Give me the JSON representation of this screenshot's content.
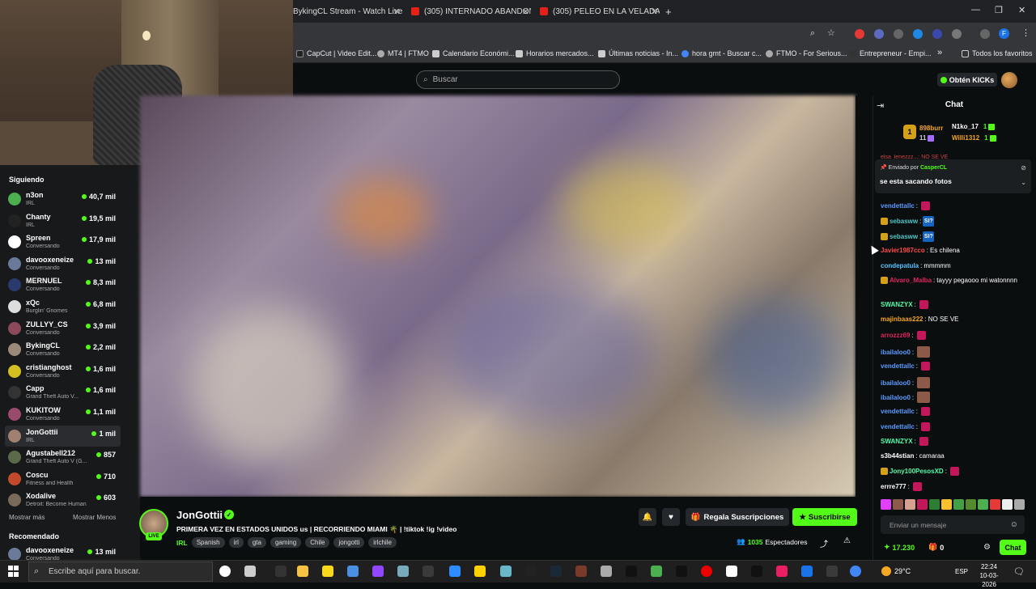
{
  "browser": {
    "tabs": [
      {
        "title": "BykingCL Stream - Watch Live o"
      },
      {
        "title": "(305) INTERNADO ABANDONA"
      },
      {
        "title": "(305) PELEO EN LA VELADA DE"
      }
    ],
    "new_tab": "+",
    "bookmarks": [
      "CapCut | Video Edit...",
      "MT4 | FTMO",
      "Calendario Económi...",
      "Horarios mercados...",
      "Últimas noticias - In...",
      "hora gmt - Buscar c...",
      "FTMO - For Serious...",
      "Entrepreneur - Empi..."
    ],
    "bookmarks_more": "»",
    "all_favorites": "Todos los favoritos",
    "profile_initial": "F"
  },
  "kick": {
    "search_placeholder": "Buscar",
    "get_kicks": "Obtén KICKs"
  },
  "sidebar": {
    "following_title": "Siguiendo",
    "following": [
      {
        "name": "n3on",
        "category": "IRL",
        "viewers": "40,7 mil",
        "color": "#4caf50"
      },
      {
        "name": "Chanty",
        "category": "IRL",
        "viewers": "19,5 mil",
        "color": "#222"
      },
      {
        "name": "Spreen",
        "category": "Conversando",
        "viewers": "17,9 mil",
        "color": "#ffffff"
      },
      {
        "name": "davooxeneize",
        "category": "Conversando",
        "viewers": "13 mil",
        "color": "#6a7a9a"
      },
      {
        "name": "MERNUEL",
        "category": "Conversando",
        "viewers": "8,3 mil",
        "color": "#2a3a6a"
      },
      {
        "name": "xQc",
        "category": "Burglin' Gnomes",
        "viewers": "6,8 mil",
        "color": "#ddd"
      },
      {
        "name": "ZULLYY_CS",
        "category": "Conversando",
        "viewers": "3,9 mil",
        "color": "#8a4a5a"
      },
      {
        "name": "BykingCL",
        "category": "Conversando",
        "viewers": "2,2 mil",
        "color": "#9a8a7a"
      },
      {
        "name": "cristianghost",
        "category": "Conversando",
        "viewers": "1,6 mil",
        "color": "#d4c020"
      },
      {
        "name": "Capp",
        "category": "Grand Theft Auto V...",
        "viewers": "1,6 mil",
        "color": "#333"
      },
      {
        "name": "KUKITOW",
        "category": "Conversando",
        "viewers": "1,1 mil",
        "color": "#9a4a6a"
      },
      {
        "name": "JonGottii",
        "category": "IRL",
        "viewers": "1 mil",
        "color": "#a08070",
        "selected": true
      },
      {
        "name": "Agustabell212",
        "category": "Grand Theft Auto V (G...",
        "viewers": "857",
        "color": "#5a6a4a"
      },
      {
        "name": "Coscu",
        "category": "Fitness and Health",
        "viewers": "710",
        "color": "#c04a2a"
      },
      {
        "name": "Xodalive",
        "category": "Detroit: Become Human",
        "viewers": "603",
        "color": "#7a6a5a"
      }
    ],
    "show_more": "Mostrar más",
    "show_less": "Mostrar Menos",
    "recommended_title": "Recomendado",
    "recommended": [
      {
        "name": "davooxeneize",
        "category": "Conversando",
        "viewers": "13 mil",
        "color": "#6a7a9a"
      }
    ]
  },
  "stream": {
    "channel": "JonGottii",
    "live_badge": "LIVE",
    "title": "PRIMERA VEZ EN ESTADOS UNIDOS us | RECORRIENDO MIAMI 🌴 | !tiktok !ig !video",
    "category": "IRL",
    "tags": [
      "Spanish",
      "irl",
      "gta",
      "gaming",
      "Chile",
      "jongotti",
      "irlchile"
    ],
    "gift_subs": "Regala Suscripciones",
    "subscribe": "Suscribirse",
    "viewers": "1035",
    "viewers_label": "Espectadores"
  },
  "chat": {
    "title": "Chat",
    "leaderboard": [
      {
        "name": "898burr",
        "count": "11",
        "color": "#f5a623"
      },
      {
        "name": "N1ko_17",
        "count": "1",
        "color": "#ffffff"
      },
      {
        "name": "Willi1312",
        "count": "1",
        "color": "#f5a623"
      }
    ],
    "leader_rank": "1",
    "partial_top": "elsa_lenezzz...: NO SE VE",
    "pinned": {
      "sent_by": "Enviado por",
      "author": "CasperCL",
      "message": "se esta sacando fotos"
    },
    "messages": [
      {
        "user": "vendettallc",
        "text": "",
        "color": "#5a9bff",
        "emote": "em"
      },
      {
        "user": "sebasww",
        "text": "SI?",
        "color": "#53c6c6",
        "emote": "si",
        "badge": true
      },
      {
        "user": "sebasww",
        "text": "SI?",
        "color": "#53c6c6",
        "emote": "si",
        "badge": true
      },
      {
        "user": "Javier1987cco",
        "text": "Es chilena",
        "color": "#ff4a4a"
      },
      {
        "user": "condepatula",
        "text": "mmmmm",
        "color": "#53c6ff"
      },
      {
        "user": "Alvaro_Malba",
        "text": "tayyy pegaooo mi watonnnn",
        "color": "#e0245e",
        "badge": true
      },
      {
        "user": "SWANZYX",
        "text": "",
        "color": "#53fcaa",
        "emote": "em"
      },
      {
        "user": "majinbaas222",
        "text": "NO SE VE",
        "color": "#f5a623"
      },
      {
        "user": "arrozzz69",
        "text": "",
        "color": "#e0245e",
        "emote": "em"
      },
      {
        "user": "ibailaloo0",
        "text": "",
        "color": "#5a9bff",
        "emote": "em2"
      },
      {
        "user": "vendettallc",
        "text": "",
        "color": "#5a9bff",
        "emote": "em"
      },
      {
        "user": "ibailaloo0",
        "text": "",
        "color": "#5a9bff",
        "emote": "em2"
      },
      {
        "user": "ibailaloo0",
        "text": "",
        "color": "#5a9bff",
        "emote": "em2"
      },
      {
        "user": "vendettallc",
        "text": "",
        "color": "#5a9bff",
        "emote": "em"
      },
      {
        "user": "vendettallc",
        "text": "",
        "color": "#5a9bff",
        "emote": "em"
      },
      {
        "user": "SWANZYX",
        "text": "",
        "color": "#53fcaa",
        "emote": "em"
      },
      {
        "user": "s3b44stian",
        "text": "camaraa",
        "color": "#ffffff"
      },
      {
        "user": "Jony100PesosXD",
        "text": "",
        "color": "#53fcaa",
        "emote": "em",
        "badge": true
      },
      {
        "user": "errre777",
        "text": "",
        "color": "#ffffff",
        "emote": "em"
      }
    ],
    "input_placeholder": "Enviar un mensaje",
    "points": "17.230",
    "gifts": "0",
    "chat_button": "Chat"
  },
  "taskbar": {
    "search_placeholder": "Escribe aquí para buscar.",
    "weather": "29°C",
    "lang": "ESP",
    "time": "22:24",
    "date": "10-03-2026"
  }
}
